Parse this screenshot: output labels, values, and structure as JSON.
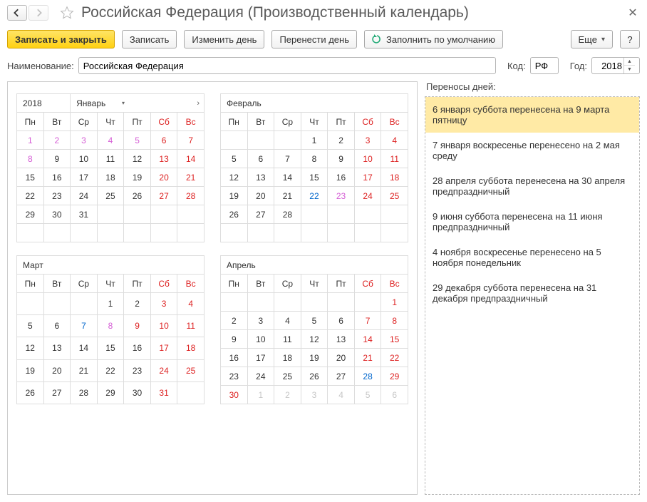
{
  "window": {
    "title": "Российская Федерация (Производственный календарь)"
  },
  "toolbar": {
    "save_close": "Записать и закрыть",
    "save": "Записать",
    "change_day": "Изменить день",
    "move_day": "Перенести день",
    "fill_default": "Заполнить по умолчанию",
    "more": "Еще",
    "help": "?"
  },
  "form": {
    "name_label": "Наименование:",
    "name_value": "Российская Федерация",
    "code_label": "Код:",
    "code_value": "РФ",
    "year_label": "Год:",
    "year_value": "2018"
  },
  "year_cell": "2018",
  "dow": [
    "Пн",
    "Вт",
    "Ср",
    "Чт",
    "Пт",
    "Сб",
    "Вс"
  ],
  "months": [
    {
      "name": "Январь",
      "has_year": true,
      "has_nav": true,
      "weeks": [
        [
          {
            "n": "1",
            "c": "hol"
          },
          {
            "n": "2",
            "c": "hol"
          },
          {
            "n": "3",
            "c": "hol"
          },
          {
            "n": "4",
            "c": "hol"
          },
          {
            "n": "5",
            "c": "hol"
          },
          {
            "n": "6",
            "c": "we"
          },
          {
            "n": "7",
            "c": "we"
          }
        ],
        [
          {
            "n": "8",
            "c": "hol"
          },
          {
            "n": "9",
            "c": "d"
          },
          {
            "n": "10",
            "c": "d"
          },
          {
            "n": "11",
            "c": "d"
          },
          {
            "n": "12",
            "c": "d"
          },
          {
            "n": "13",
            "c": "we"
          },
          {
            "n": "14",
            "c": "we"
          }
        ],
        [
          {
            "n": "15",
            "c": "d"
          },
          {
            "n": "16",
            "c": "d"
          },
          {
            "n": "17",
            "c": "d"
          },
          {
            "n": "18",
            "c": "d"
          },
          {
            "n": "19",
            "c": "d"
          },
          {
            "n": "20",
            "c": "we"
          },
          {
            "n": "21",
            "c": "we"
          }
        ],
        [
          {
            "n": "22",
            "c": "d"
          },
          {
            "n": "23",
            "c": "d"
          },
          {
            "n": "24",
            "c": "d"
          },
          {
            "n": "25",
            "c": "d"
          },
          {
            "n": "26",
            "c": "d"
          },
          {
            "n": "27",
            "c": "we"
          },
          {
            "n": "28",
            "c": "we"
          }
        ],
        [
          {
            "n": "29",
            "c": "d"
          },
          {
            "n": "30",
            "c": "d"
          },
          {
            "n": "31",
            "c": "d"
          },
          {
            "n": "",
            "c": ""
          },
          {
            "n": "",
            "c": ""
          },
          {
            "n": "",
            "c": ""
          },
          {
            "n": "",
            "c": ""
          }
        ],
        [
          {
            "n": "",
            "c": ""
          },
          {
            "n": "",
            "c": ""
          },
          {
            "n": "",
            "c": ""
          },
          {
            "n": "",
            "c": ""
          },
          {
            "n": "",
            "c": ""
          },
          {
            "n": "",
            "c": ""
          },
          {
            "n": "",
            "c": ""
          }
        ]
      ]
    },
    {
      "name": "Февраль",
      "weeks": [
        [
          {
            "n": "",
            "c": ""
          },
          {
            "n": "",
            "c": ""
          },
          {
            "n": "",
            "c": ""
          },
          {
            "n": "1",
            "c": "d"
          },
          {
            "n": "2",
            "c": "d"
          },
          {
            "n": "3",
            "c": "we"
          },
          {
            "n": "4",
            "c": "we"
          }
        ],
        [
          {
            "n": "5",
            "c": "d"
          },
          {
            "n": "6",
            "c": "d"
          },
          {
            "n": "7",
            "c": "d"
          },
          {
            "n": "8",
            "c": "d"
          },
          {
            "n": "9",
            "c": "d"
          },
          {
            "n": "10",
            "c": "we"
          },
          {
            "n": "11",
            "c": "we"
          }
        ],
        [
          {
            "n": "12",
            "c": "d"
          },
          {
            "n": "13",
            "c": "d"
          },
          {
            "n": "14",
            "c": "d"
          },
          {
            "n": "15",
            "c": "d"
          },
          {
            "n": "16",
            "c": "d"
          },
          {
            "n": "17",
            "c": "we"
          },
          {
            "n": "18",
            "c": "we"
          }
        ],
        [
          {
            "n": "19",
            "c": "d"
          },
          {
            "n": "20",
            "c": "d"
          },
          {
            "n": "21",
            "c": "d"
          },
          {
            "n": "22",
            "c": "pre"
          },
          {
            "n": "23",
            "c": "hol"
          },
          {
            "n": "24",
            "c": "we"
          },
          {
            "n": "25",
            "c": "we"
          }
        ],
        [
          {
            "n": "26",
            "c": "d"
          },
          {
            "n": "27",
            "c": "d"
          },
          {
            "n": "28",
            "c": "d"
          },
          {
            "n": "",
            "c": ""
          },
          {
            "n": "",
            "c": ""
          },
          {
            "n": "",
            "c": ""
          },
          {
            "n": "",
            "c": ""
          }
        ],
        [
          {
            "n": "",
            "c": ""
          },
          {
            "n": "",
            "c": ""
          },
          {
            "n": "",
            "c": ""
          },
          {
            "n": "",
            "c": ""
          },
          {
            "n": "",
            "c": ""
          },
          {
            "n": "",
            "c": ""
          },
          {
            "n": "",
            "c": ""
          }
        ]
      ]
    },
    {
      "name": "Март",
      "weeks": [
        [
          {
            "n": "",
            "c": ""
          },
          {
            "n": "",
            "c": ""
          },
          {
            "n": "",
            "c": ""
          },
          {
            "n": "1",
            "c": "d"
          },
          {
            "n": "2",
            "c": "d"
          },
          {
            "n": "3",
            "c": "we"
          },
          {
            "n": "4",
            "c": "we"
          }
        ],
        [
          {
            "n": "5",
            "c": "d"
          },
          {
            "n": "6",
            "c": "d"
          },
          {
            "n": "7",
            "c": "pre"
          },
          {
            "n": "8",
            "c": "hol"
          },
          {
            "n": "9",
            "c": "we"
          },
          {
            "n": "10",
            "c": "we"
          },
          {
            "n": "11",
            "c": "we"
          }
        ],
        [
          {
            "n": "12",
            "c": "d"
          },
          {
            "n": "13",
            "c": "d"
          },
          {
            "n": "14",
            "c": "d"
          },
          {
            "n": "15",
            "c": "d"
          },
          {
            "n": "16",
            "c": "d"
          },
          {
            "n": "17",
            "c": "we"
          },
          {
            "n": "18",
            "c": "we"
          }
        ],
        [
          {
            "n": "19",
            "c": "d"
          },
          {
            "n": "20",
            "c": "d"
          },
          {
            "n": "21",
            "c": "d"
          },
          {
            "n": "22",
            "c": "d"
          },
          {
            "n": "23",
            "c": "d"
          },
          {
            "n": "24",
            "c": "we"
          },
          {
            "n": "25",
            "c": "we"
          }
        ],
        [
          {
            "n": "26",
            "c": "d"
          },
          {
            "n": "27",
            "c": "d"
          },
          {
            "n": "28",
            "c": "d"
          },
          {
            "n": "29",
            "c": "d"
          },
          {
            "n": "30",
            "c": "d"
          },
          {
            "n": "31",
            "c": "we"
          },
          {
            "n": "",
            "c": ""
          }
        ]
      ]
    },
    {
      "name": "Апрель",
      "weeks": [
        [
          {
            "n": "",
            "c": ""
          },
          {
            "n": "",
            "c": ""
          },
          {
            "n": "",
            "c": ""
          },
          {
            "n": "",
            "c": ""
          },
          {
            "n": "",
            "c": ""
          },
          {
            "n": "",
            "c": ""
          },
          {
            "n": "1",
            "c": "we"
          }
        ],
        [
          {
            "n": "2",
            "c": "d"
          },
          {
            "n": "3",
            "c": "d"
          },
          {
            "n": "4",
            "c": "d"
          },
          {
            "n": "5",
            "c": "d"
          },
          {
            "n": "6",
            "c": "d"
          },
          {
            "n": "7",
            "c": "we"
          },
          {
            "n": "8",
            "c": "we"
          }
        ],
        [
          {
            "n": "9",
            "c": "d"
          },
          {
            "n": "10",
            "c": "d"
          },
          {
            "n": "11",
            "c": "d"
          },
          {
            "n": "12",
            "c": "d"
          },
          {
            "n": "13",
            "c": "d"
          },
          {
            "n": "14",
            "c": "we"
          },
          {
            "n": "15",
            "c": "we"
          }
        ],
        [
          {
            "n": "16",
            "c": "d"
          },
          {
            "n": "17",
            "c": "d"
          },
          {
            "n": "18",
            "c": "d"
          },
          {
            "n": "19",
            "c": "d"
          },
          {
            "n": "20",
            "c": "d"
          },
          {
            "n": "21",
            "c": "we"
          },
          {
            "n": "22",
            "c": "we"
          }
        ],
        [
          {
            "n": "23",
            "c": "d"
          },
          {
            "n": "24",
            "c": "d"
          },
          {
            "n": "25",
            "c": "d"
          },
          {
            "n": "26",
            "c": "d"
          },
          {
            "n": "27",
            "c": "d"
          },
          {
            "n": "28",
            "c": "pre"
          },
          {
            "n": "29",
            "c": "we"
          }
        ],
        [
          {
            "n": "30",
            "c": "we"
          },
          {
            "n": "1",
            "c": "oth"
          },
          {
            "n": "2",
            "c": "oth"
          },
          {
            "n": "3",
            "c": "oth"
          },
          {
            "n": "4",
            "c": "oth"
          },
          {
            "n": "5",
            "c": "oth"
          },
          {
            "n": "6",
            "c": "oth"
          }
        ]
      ]
    }
  ],
  "transfers": {
    "title": "Переносы дней:",
    "items": [
      "6 января суббота перенесена на 9 марта пятницу",
      "7 января воскресенье перенесено на 2 мая среду",
      "28 апреля суббота перенесена на 30 апреля предпраздничный",
      "9 июня суббота перенесена на 11 июня предпраздничный",
      "4 ноября воскресенье перенесено на 5 ноября понедельник",
      "29 декабря суббота перенесена на 31 декабря предпраздничный"
    ],
    "selected": 0
  }
}
